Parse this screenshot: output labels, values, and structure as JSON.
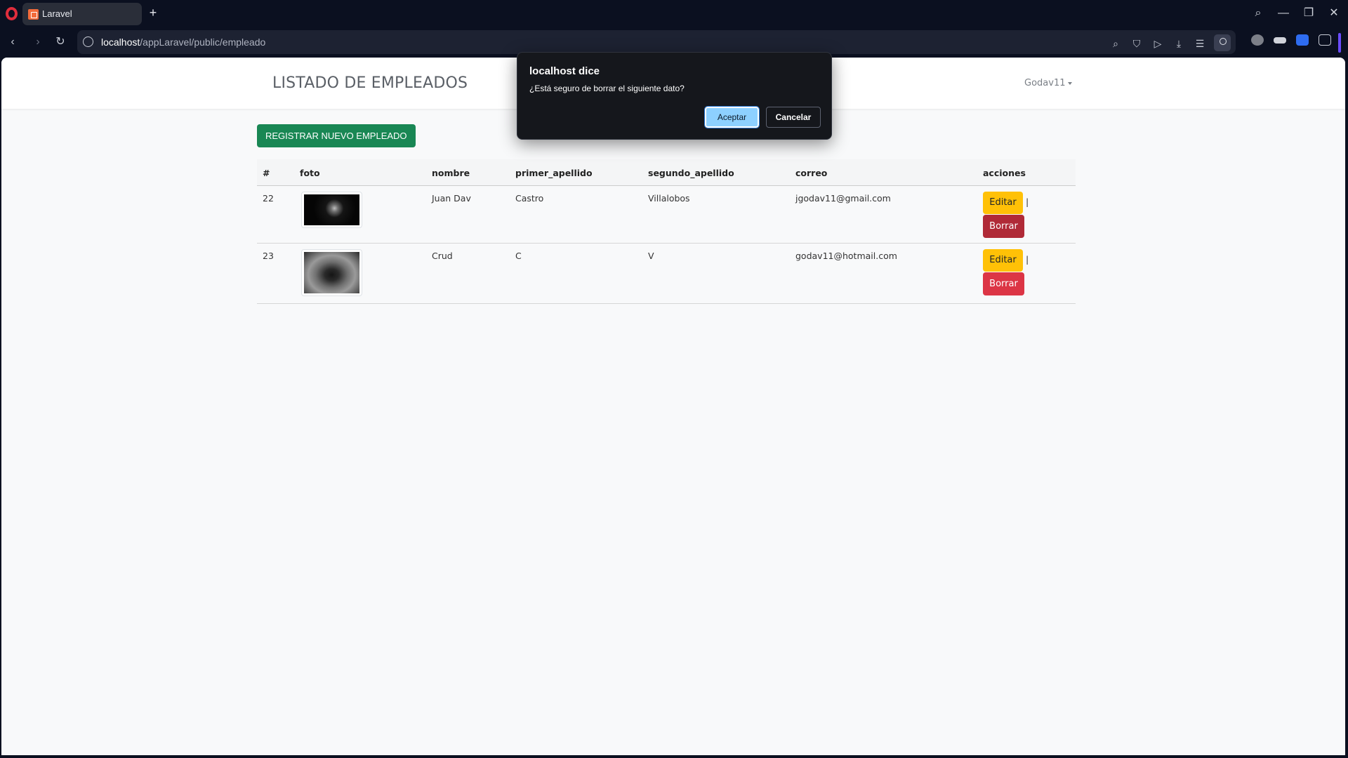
{
  "browser": {
    "tab_title": "Laravel",
    "url_host": "localhost",
    "url_path": "/appLaravel/public/empleado",
    "icons": [
      "opera-logo",
      "new-tab-icon",
      "search-icon",
      "minimize-icon",
      "maximize-icon",
      "close-icon",
      "back-icon",
      "forward-icon",
      "reload-icon",
      "site-info-icon",
      "zoom-icon",
      "shield-icon",
      "play-icon",
      "download-icon",
      "settings-icon",
      "profile-icon",
      "adblock-icon",
      "wallet-icon",
      "translate-icon",
      "box-icon"
    ]
  },
  "navbar": {
    "brand": "LISTADO DE EMPLEADOS",
    "user": "Godav11"
  },
  "page": {
    "register_button": "REGISTRAR NUEVO EMPLEADO"
  },
  "table": {
    "headers": [
      "#",
      "foto",
      "nombre",
      "primer_apellido",
      "segundo_apellido",
      "correo",
      "acciones"
    ],
    "rows": [
      {
        "id": "22",
        "nombre": "Juan Dav",
        "primer_apellido": "Castro",
        "segundo_apellido": "Villalobos",
        "correo": "jgodav11@gmail.com",
        "edit": "Editar",
        "separator": "|",
        "delete": "Borrar"
      },
      {
        "id": "23",
        "nombre": "Crud",
        "primer_apellido": "C",
        "segundo_apellido": "V",
        "correo": "godav11@hotmail.com",
        "edit": "Editar",
        "separator": "|",
        "delete": "Borrar"
      }
    ]
  },
  "dialog": {
    "title": "localhost dice",
    "message": "¿Está seguro de borrar el siguiente dato?",
    "accept": "Aceptar",
    "cancel": "Cancelar"
  },
  "colors": {
    "success": "#198754",
    "warning": "#ffc107",
    "danger": "#dc3545",
    "dialog_accent": "#8dd0ff"
  }
}
